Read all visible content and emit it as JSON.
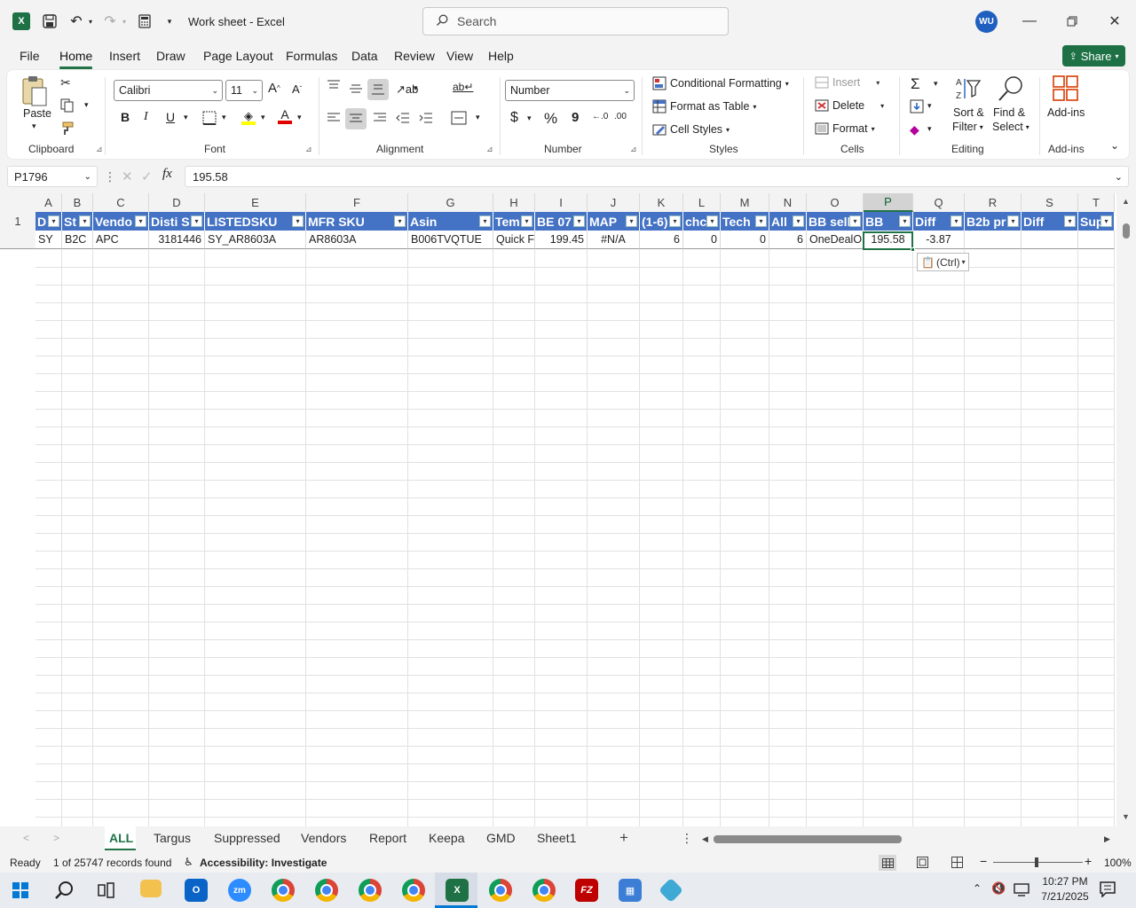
{
  "window": {
    "title": "Work sheet  -  Excel",
    "search_placeholder": "Search",
    "user_initials": "WU"
  },
  "menu": [
    "File",
    "Home",
    "Insert",
    "Draw",
    "Page Layout",
    "Formulas",
    "Data",
    "Review",
    "View",
    "Help"
  ],
  "share_label": "Share",
  "ribbon": {
    "clipboard": {
      "paste": "Paste",
      "label": "Clipboard"
    },
    "font": {
      "name": "Calibri",
      "size": "11",
      "label": "Font",
      "bold": "B",
      "italic": "I",
      "underline": "U"
    },
    "alignment": {
      "label": "Alignment"
    },
    "number": {
      "format": "Number",
      "label": "Number",
      "currency": "$",
      "percent": "%",
      "comma": "9"
    },
    "styles": {
      "conditional": "Conditional Formatting",
      "format_table": "Format as Table",
      "cell_styles": "Cell Styles",
      "label": "Styles"
    },
    "cells": {
      "insert": "Insert",
      "delete": "Delete",
      "format": "Format",
      "label": "Cells"
    },
    "editing": {
      "sort1": "Sort &",
      "sort2": "Filter",
      "find1": "Find &",
      "find2": "Select",
      "label": "Editing"
    },
    "addins": {
      "name": "Add-ins",
      "label": "Add-ins"
    }
  },
  "formula_bar": {
    "name_box": "P1796",
    "fx": "fx",
    "value": "195.58"
  },
  "columns": [
    "A",
    "B",
    "C",
    "D",
    "E",
    "F",
    "G",
    "H",
    "I",
    "J",
    "K",
    "L",
    "M",
    "N",
    "O",
    "P",
    "Q",
    "R",
    "S",
    "T"
  ],
  "selected_column": "P",
  "rows": [
    "1"
  ],
  "header_row": [
    "D",
    "St",
    "Vendo",
    "Disti S",
    "LISTEDSKU",
    "MFR SKU",
    "Asin",
    "Tem",
    "BE 07",
    "MAP",
    "(1-6)",
    "chc",
    "Tech",
    "All",
    "BB sell",
    "BB",
    "Diff",
    "B2b pr",
    "Diff",
    "Sup"
  ],
  "data_row": [
    "SY",
    "B2C",
    "APC",
    "3181446",
    "SY_AR8603A",
    "AR8603A",
    "B006TVQTUE",
    "Quick F",
    "199.45",
    "#N/A",
    "6",
    "0",
    "0",
    "6",
    "OneDealO",
    "195.58",
    "-3.87",
    "",
    "",
    ""
  ],
  "paste_tag": "(Ctrl)",
  "sheets": [
    "ALL",
    "Targus",
    "Suppressed",
    "Vendors",
    "Report",
    "Keepa",
    "GMD",
    "Sheet1"
  ],
  "active_sheet": "ALL",
  "status": {
    "ready": "Ready",
    "records": "1 of 25747 records found",
    "accessibility": "Accessibility: Investigate",
    "zoom": "100%"
  },
  "taskbar": {
    "time": "10:27 PM",
    "date": "7/21/2025"
  }
}
